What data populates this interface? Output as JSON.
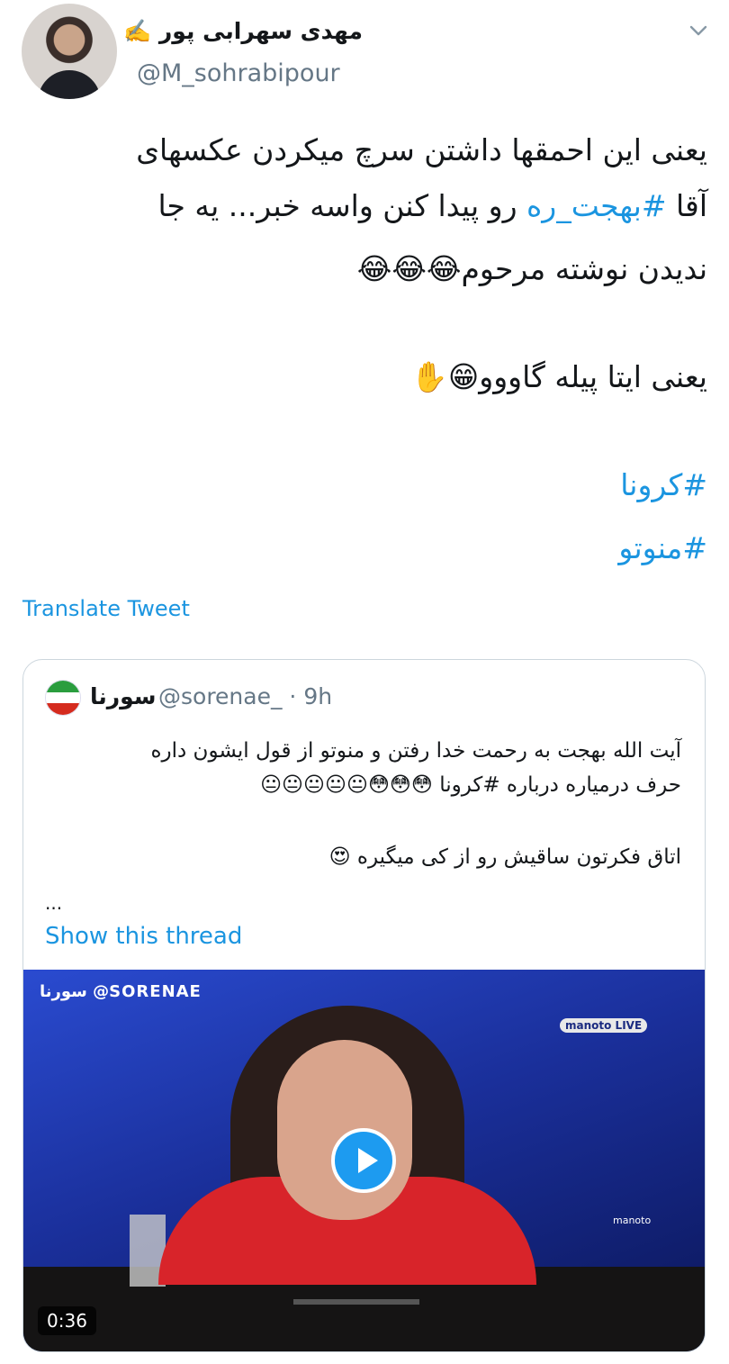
{
  "author": {
    "display_name": "مهدی سهرابی پور ✍️",
    "handle": "@M_sohrabipour"
  },
  "tweet": {
    "line1": "یعنی این احمقها داشتن سرچ میکردن عکسهای",
    "line2_prefix": "آقا ",
    "line2_hashtag": "#بهجت_ره",
    "line2_suffix": " رو پیدا کنن واسه خبر... یه جا",
    "line3": "ندیدن نوشته مرحوم😂😂😂",
    "line4": "یعنی ایتا پیله گاووو😁✋",
    "hashtag1": "#کرونا",
    "hashtag2": "#منوتو"
  },
  "translate_label": "Translate Tweet",
  "quote": {
    "display_name": "سورنا",
    "meta": "@sorenae_ · 9h",
    "line1": "آیت الله بهجت به رحمت خدا رفتن و منوتو از قول ایشون داره",
    "line2": "حرف درمیاره درباره #کرونا 😳😳😳😐😐😐😐😐",
    "line3": "اتاق فکرتون ساقیش رو از کی میگیره 😍",
    "ellipsis": "...",
    "show_thread_label": "Show this thread"
  },
  "video": {
    "watermark_left": "سورنا @SORENAE",
    "watermark_right": "manoto LIVE",
    "watermark_corner": "manoto",
    "duration": "0:36"
  },
  "colors": {
    "link": "#1b95e0",
    "secondary_text": "#657786",
    "border": "#ccd6dd"
  },
  "icons": [
    "chevron-down-icon",
    "play-icon"
  ]
}
